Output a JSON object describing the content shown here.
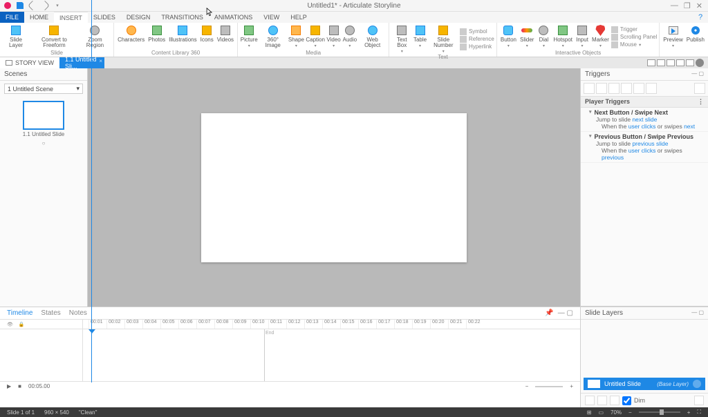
{
  "titlebar": {
    "title": "Untitled1* - Articulate Storyline",
    "minimize": "—",
    "maximize": "❐",
    "close": "✕"
  },
  "menus": {
    "file": "FILE",
    "home": "HOME",
    "insert": "INSERT",
    "slides": "SLIDES",
    "design": "DESIGN",
    "transitions": "TRANSITIONS",
    "animations": "ANIMATIONS",
    "view": "VIEW",
    "help": "HELP"
  },
  "ribbon": {
    "slide": {
      "slide_layer": "Slide\nLayer",
      "convert_to_freeform": "Convert to\nFreeform",
      "zoom_region": "Zoom\nRegion",
      "group": "Slide"
    },
    "content_library": {
      "characters": "Characters",
      "photos": "Photos",
      "illustrations": "Illustrations",
      "icons": "Icons",
      "videos": "Videos",
      "group": "Content Library 360"
    },
    "media": {
      "picture": "Picture",
      "image360": "360°\nImage",
      "shape": "Shape",
      "caption": "Caption",
      "video": "Video",
      "audio": "Audio",
      "web_object": "Web\nObject",
      "group": "Media"
    },
    "text": {
      "text_box": "Text\nBox",
      "table": "Table",
      "slide_number": "Slide\nNumber",
      "symbol": "Symbol",
      "reference": "Reference",
      "hyperlink": "Hyperlink",
      "group": "Text"
    },
    "interactive": {
      "button": "Button",
      "slider": "Slider",
      "dial": "Dial",
      "hotspot": "Hotspot",
      "input": "Input",
      "marker": "Marker",
      "trigger": "Trigger",
      "scrolling_panel": "Scrolling Panel",
      "mouse": "Mouse",
      "group": "Interactive Objects"
    },
    "publish": {
      "preview": "Preview",
      "publish": "Publish"
    }
  },
  "secbar": {
    "story_view": "STORY VIEW",
    "slide_tab": "1.1 Untitled Sli..."
  },
  "scenes": {
    "header": "Scenes",
    "select": "1 Untitled Scene",
    "thumb_label": "1.1 Untitled Slide"
  },
  "triggers": {
    "header": "Triggers",
    "player_triggers": "Player Triggers",
    "next": {
      "title": "Next Button / Swipe Next",
      "jump": "Jump to slide ",
      "jump_link": "next slide",
      "when": "When the ",
      "when_a": "user clicks",
      "when_mid": " or swipes ",
      "when_b": "next"
    },
    "prev": {
      "title": "Previous Button / Swipe Previous",
      "jump": "Jump to slide ",
      "jump_link": "previous slide",
      "when": "When the ",
      "when_a": "user clicks",
      "when_mid": " or swipes ",
      "when_b": "previous"
    }
  },
  "layers": {
    "header": "Slide Layers",
    "base_name": "Untitled Slide",
    "base_type": "(Base Layer)",
    "dim": "Dim"
  },
  "timeline": {
    "tab_timeline": "Timeline",
    "tab_states": "States",
    "tab_notes": "Notes",
    "ticks": [
      "00:01",
      "00:02",
      "00:03",
      "00:04",
      "00:05",
      "00:06",
      "00:07",
      "00:08",
      "00:09",
      "00:10",
      "00:11",
      "00:12",
      "00:13",
      "00:14",
      "00:15",
      "00:16",
      "00:17",
      "00:18",
      "00:19",
      "00:20",
      "00:21",
      "00:22"
    ],
    "end": "End",
    "footer_time": "00:05.00"
  },
  "status": {
    "slide": "Slide 1 of 1",
    "dims": "960 × 540",
    "theme": "\"Clean\"",
    "zoom": "70%"
  }
}
